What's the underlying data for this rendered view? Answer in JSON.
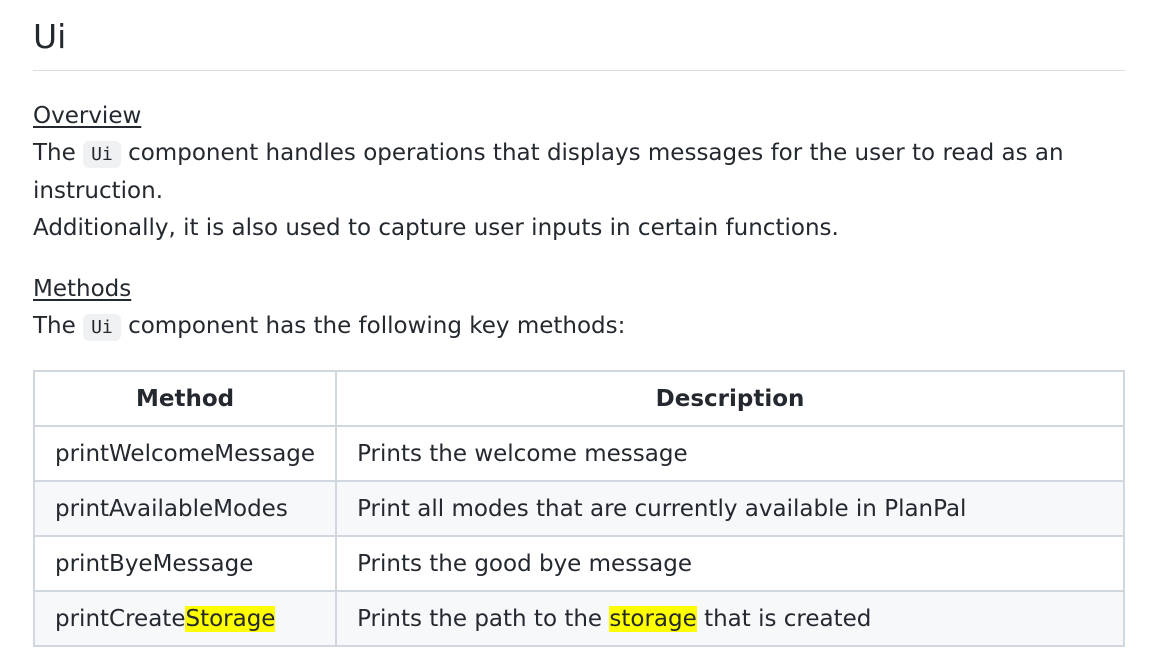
{
  "page_title": "Ui",
  "overview": {
    "heading": "Overview",
    "line1_prefix": "The",
    "code": "Ui",
    "line1_suffix": "component handles operations that displays messages for the user to read as an instruction.",
    "line2": "Additionally, it is also used to capture user inputs in certain functions."
  },
  "methods": {
    "heading": "Methods",
    "intro_prefix": "The",
    "code": "Ui",
    "intro_suffix": "component has the following key methods:"
  },
  "table": {
    "headers": [
      "Method",
      "Description"
    ],
    "rows": [
      {
        "method": "printWelcomeMessage",
        "description": "Prints the welcome message"
      },
      {
        "method": "printAvailableModes",
        "description": "Print all modes that are currently available in PlanPal"
      },
      {
        "method": "printByeMessage",
        "description": "Prints the good bye message"
      },
      {
        "method_prefix": "printCreate",
        "method_highlight": "Storage",
        "desc_prefix": "Prints the path to the",
        "desc_highlight": "storage",
        "desc_suffix": "that is created"
      }
    ]
  },
  "colors": {
    "highlight": "#ffff00",
    "border": "#d0d7de",
    "code_bg": "#eff1f3",
    "stripe": "#f6f8fa"
  }
}
